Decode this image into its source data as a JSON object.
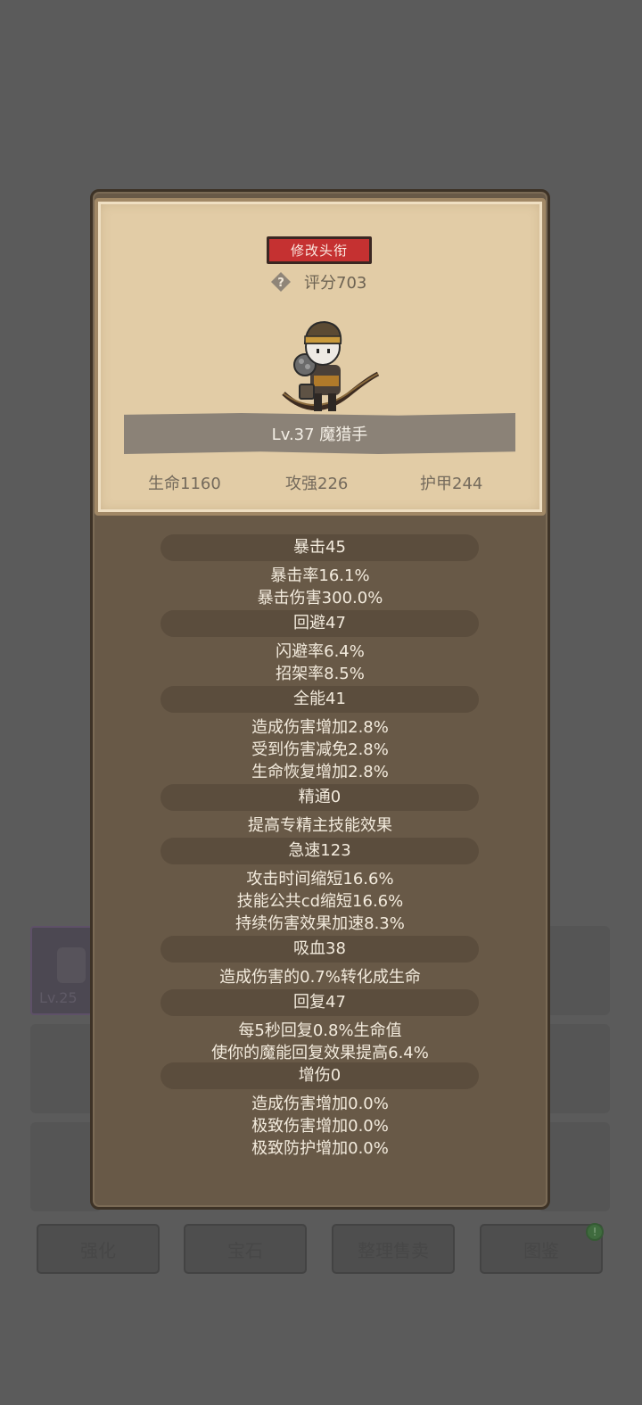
{
  "background": {
    "item_level": "Lv.25",
    "bottom_buttons": [
      "强化",
      "宝石",
      "整理售卖",
      "图鉴"
    ]
  },
  "header": {
    "title_button": "修改头衔",
    "score": "评分703",
    "character_name": "Lv.37 魔猎手",
    "stats": {
      "hp": "生命1160",
      "attack": "攻强226",
      "armor": "护甲244"
    }
  },
  "sections": [
    {
      "title": "暴击45",
      "lines": [
        "暴击率16.1%",
        "暴击伤害300.0%"
      ]
    },
    {
      "title": "回避47",
      "lines": [
        "闪避率6.4%",
        "招架率8.5%"
      ]
    },
    {
      "title": "全能41",
      "lines": [
        "造成伤害增加2.8%",
        "受到伤害减免2.8%",
        "生命恢复增加2.8%"
      ]
    },
    {
      "title": "精通0",
      "lines": [
        "提高专精主技能效果"
      ]
    },
    {
      "title": "急速123",
      "lines": [
        "攻击时间缩短16.6%",
        "技能公共cd缩短16.6%",
        "持续伤害效果加速8.3%"
      ]
    },
    {
      "title": "吸血38",
      "lines": [
        "造成伤害的0.7%转化成生命"
      ]
    },
    {
      "title": "回复47",
      "lines": [
        "每5秒回复0.8%生命值",
        "使你的魔能回复效果提高6.4%"
      ]
    },
    {
      "title": "增伤0",
      "lines": [
        "造成伤害增加0.0%",
        "极致伤害增加0.0%",
        "极致防护增加0.0%"
      ]
    }
  ],
  "icons": {
    "help": "help-icon",
    "notification": "notification-dot"
  },
  "colors": {
    "title_button": "#c53131",
    "panel_light": "#e2cca6",
    "panel_dark": "#685947"
  }
}
